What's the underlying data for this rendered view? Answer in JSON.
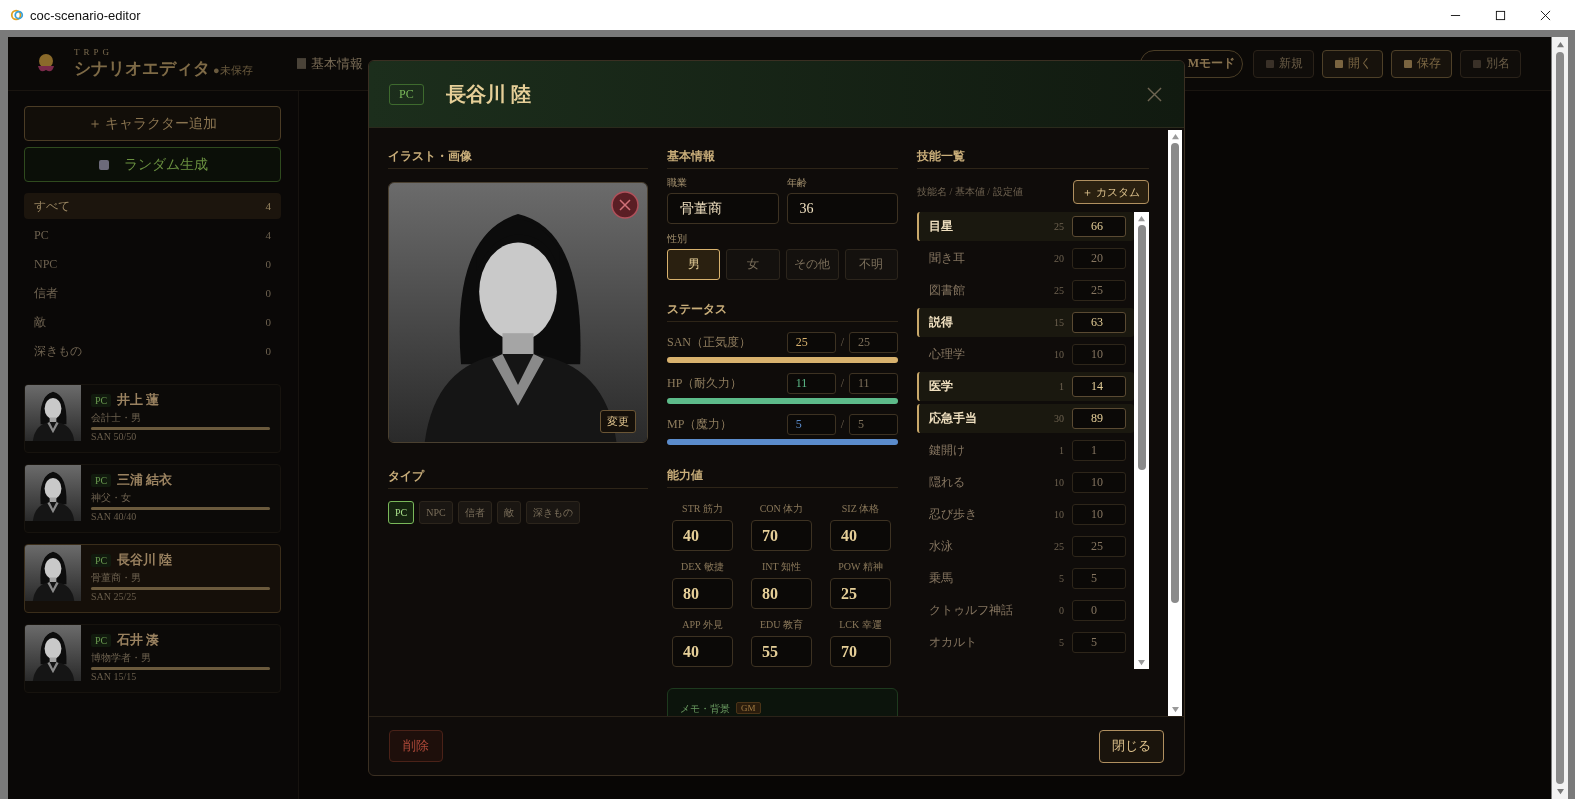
{
  "window": {
    "title": "coc-scenario-editor"
  },
  "app_header": {
    "eyebrow": "TRPG",
    "title": "シナリオエディタ",
    "unsaved": "●未保存",
    "nav_item": "基本情報",
    "gm_mode": "Mモード",
    "buttons": [
      {
        "label": "新規",
        "disabled": true
      },
      {
        "label": "開く",
        "disabled": false
      },
      {
        "label": "保存",
        "disabled": false
      },
      {
        "label": "別名",
        "disabled": true
      }
    ]
  },
  "sidebar": {
    "add_button": "＋ キャラクター追加",
    "random_button": "ランダム生成",
    "filters": [
      {
        "label": "すべて",
        "count": "4",
        "selected": true
      },
      {
        "label": "PC",
        "count": "4",
        "selected": false
      },
      {
        "label": "NPC",
        "count": "0",
        "selected": false
      },
      {
        "label": "信者",
        "count": "0",
        "selected": false
      },
      {
        "label": "敵",
        "count": "0",
        "selected": false
      },
      {
        "label": "深きもの",
        "count": "0",
        "selected": false
      }
    ],
    "characters": [
      {
        "type": "PC",
        "name": "井上 蓮",
        "subtitle": "会計士・男",
        "san": "SAN 50/50",
        "level": 1,
        "selected": false
      },
      {
        "type": "PC",
        "name": "三浦 結衣",
        "subtitle": "神父・女",
        "san": "SAN 40/40",
        "level": 1,
        "selected": false
      },
      {
        "type": "PC",
        "name": "長谷川 陸",
        "subtitle": "骨董商・男",
        "san": "SAN 25/25",
        "level": 1,
        "selected": true
      },
      {
        "type": "PC",
        "name": "石井 湊",
        "subtitle": "博物学者・男",
        "san": "SAN 15/15",
        "level": 1,
        "selected": false
      }
    ]
  },
  "dialog": {
    "type_badge": "PC",
    "name": "長谷川 陸",
    "image_section": {
      "heading": "イラスト・画像",
      "change_button": "変更"
    },
    "type_section": {
      "heading": "タイプ",
      "options": [
        {
          "label": "PC",
          "selected": true
        },
        {
          "label": "NPC",
          "selected": false
        },
        {
          "label": "信者",
          "selected": false
        },
        {
          "label": "敵",
          "selected": false
        },
        {
          "label": "深きもの",
          "selected": false
        }
      ]
    },
    "basic_info": {
      "heading": "基本情報",
      "occupation_label": "職業",
      "occupation": "骨董商",
      "age_label": "年齢",
      "age": "36",
      "gender_label": "性別",
      "genders": [
        {
          "label": "男",
          "selected": true
        },
        {
          "label": "女",
          "selected": false
        },
        {
          "label": "その他",
          "selected": false
        },
        {
          "label": "不明",
          "selected": false
        }
      ]
    },
    "status": {
      "heading": "ステータス",
      "meters": [
        {
          "label": "SAN（正気度）",
          "current": "25",
          "separator": "/",
          "max": "25",
          "level": 1,
          "color": "#d8b26e"
        },
        {
          "label": "HP（耐久力）",
          "current": "11",
          "separator": "/",
          "max": "11",
          "level": 1,
          "color": "#5dbb8a"
        },
        {
          "label": "MP（魔力）",
          "current": "5",
          "separator": "/",
          "max": "5",
          "level": 1,
          "color": "#5b8ccc"
        }
      ]
    },
    "abilities": {
      "heading": "能力値",
      "items": [
        {
          "label": "STR 筋力",
          "value": "40"
        },
        {
          "label": "CON 体力",
          "value": "70"
        },
        {
          "label": "SIZ 体格",
          "value": "40"
        },
        {
          "label": "DEX 敏捷",
          "value": "80"
        },
        {
          "label": "INT 知性",
          "value": "80"
        },
        {
          "label": "POW 精神",
          "value": "25"
        },
        {
          "label": "APP 外見",
          "value": "40"
        },
        {
          "label": "EDU 教育",
          "value": "55"
        },
        {
          "label": "LCK 幸運",
          "value": "70"
        }
      ]
    },
    "memo": {
      "label": "メモ・背景",
      "badge": "GM"
    },
    "skills": {
      "heading": "技能一覧",
      "hint": "技能名 / 基本値 / 設定値",
      "custom_button": "＋ カスタム",
      "items": [
        {
          "name": "目星",
          "base": "25",
          "value": "66",
          "changed": true
        },
        {
          "name": "聞き耳",
          "base": "20",
          "value": "20",
          "changed": false
        },
        {
          "name": "図書館",
          "base": "25",
          "value": "25",
          "changed": false
        },
        {
          "name": "説得",
          "base": "15",
          "value": "63",
          "changed": true
        },
        {
          "name": "心理学",
          "base": "10",
          "value": "10",
          "changed": false
        },
        {
          "name": "医学",
          "base": "1",
          "value": "14",
          "changed": true
        },
        {
          "name": "応急手当",
          "base": "30",
          "value": "89",
          "changed": true
        },
        {
          "name": "鍵開け",
          "base": "1",
          "value": "1",
          "changed": false
        },
        {
          "name": "隠れる",
          "base": "10",
          "value": "10",
          "changed": false
        },
        {
          "name": "忍び歩き",
          "base": "10",
          "value": "10",
          "changed": false
        },
        {
          "name": "水泳",
          "base": "25",
          "value": "25",
          "changed": false
        },
        {
          "name": "乗馬",
          "base": "5",
          "value": "5",
          "changed": false
        },
        {
          "name": "クトゥルフ神話",
          "base": "0",
          "value": "0",
          "changed": false
        },
        {
          "name": "オカルト",
          "base": "5",
          "value": "5",
          "changed": false
        }
      ]
    },
    "delete_button": "削除",
    "close_button": "閉じる"
  }
}
